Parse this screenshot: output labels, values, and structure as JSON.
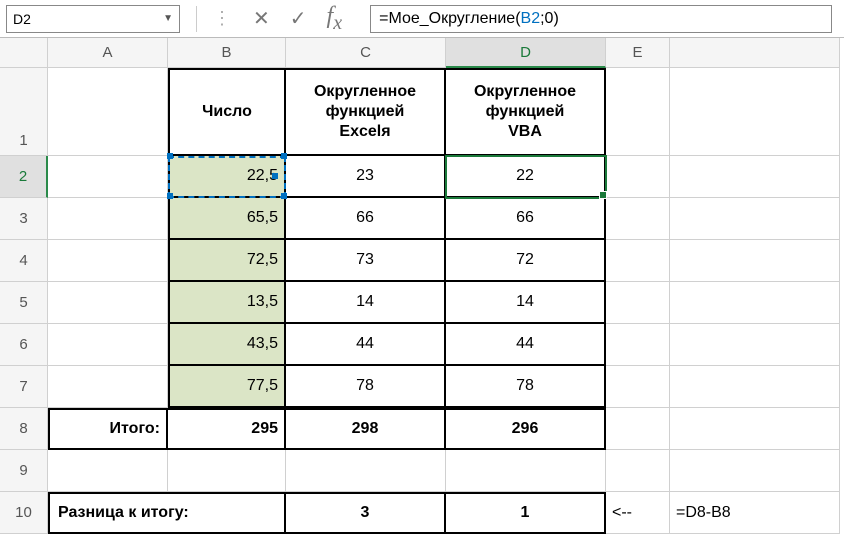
{
  "namebox": "D2",
  "formula": {
    "prefix": "=Мое_Округление(",
    "ref": "B2",
    "suffix": ";0)"
  },
  "columns": [
    "",
    "A",
    "B",
    "C",
    "D",
    "E",
    ""
  ],
  "rows": [
    "1",
    "2",
    "3",
    "4",
    "5",
    "6",
    "7",
    "8",
    "9",
    "10"
  ],
  "headers": {
    "B": "Число",
    "C": "Округленное\nфункцией\nExcelя",
    "D": "Округленное\nфункцией\nVBA"
  },
  "data": [
    {
      "B": "22,5",
      "C": "23",
      "D": "22"
    },
    {
      "B": "65,5",
      "C": "66",
      "D": "66"
    },
    {
      "B": "72,5",
      "C": "73",
      "D": "72"
    },
    {
      "B": "13,5",
      "C": "14",
      "D": "14"
    },
    {
      "B": "43,5",
      "C": "44",
      "D": "44"
    },
    {
      "B": "77,5",
      "C": "78",
      "D": "78"
    }
  ],
  "totals": {
    "label": "Итого:",
    "B": "295",
    "C": "298",
    "D": "296"
  },
  "diff": {
    "label": "Разница к итогу:",
    "C": "3",
    "D": "1",
    "arrow": "<--",
    "formula": "=D8-B8"
  },
  "chart_data": {
    "type": "table",
    "title": "Rounding comparison Excel vs VBA",
    "columns": [
      "Число",
      "Округленное функцией Excelя",
      "Округленное функцией VBA"
    ],
    "rows": [
      [
        22.5,
        23,
        22
      ],
      [
        65.5,
        66,
        66
      ],
      [
        72.5,
        73,
        72
      ],
      [
        13.5,
        14,
        14
      ],
      [
        43.5,
        44,
        44
      ],
      [
        77.5,
        78,
        78
      ]
    ],
    "totals": [
      295,
      298,
      296
    ],
    "diff_to_total": {
      "Excel": 3,
      "VBA": 1
    }
  }
}
